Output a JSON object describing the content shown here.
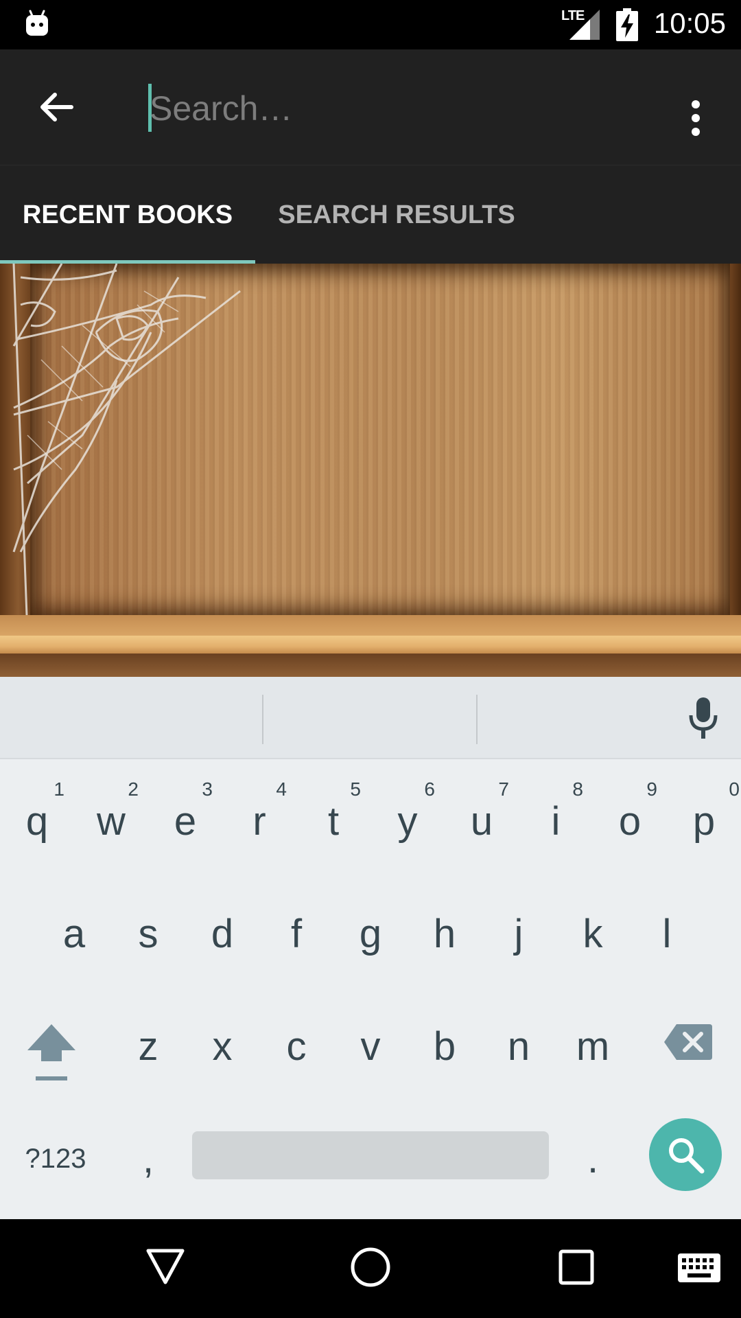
{
  "status_bar": {
    "network_label": "LTE",
    "time": "10:05"
  },
  "app_bar": {
    "search_placeholder": "Search…",
    "search_value": ""
  },
  "tabs": [
    {
      "label": "RECENT BOOKS",
      "selected": true
    },
    {
      "label": "SEARCH RESULTS",
      "selected": false
    }
  ],
  "keyboard": {
    "row1": [
      {
        "key": "q",
        "hint": "1"
      },
      {
        "key": "w",
        "hint": "2"
      },
      {
        "key": "e",
        "hint": "3"
      },
      {
        "key": "r",
        "hint": "4"
      },
      {
        "key": "t",
        "hint": "5"
      },
      {
        "key": "y",
        "hint": "6"
      },
      {
        "key": "u",
        "hint": "7"
      },
      {
        "key": "i",
        "hint": "8"
      },
      {
        "key": "o",
        "hint": "9"
      },
      {
        "key": "p",
        "hint": "0"
      }
    ],
    "row2": [
      "a",
      "s",
      "d",
      "f",
      "g",
      "h",
      "j",
      "k",
      "l"
    ],
    "row3": [
      "z",
      "x",
      "c",
      "v",
      "b",
      "n",
      "m"
    ],
    "symbols_key": "?123",
    "comma_key": ",",
    "period_key": "."
  },
  "colors": {
    "accent": "#4db6ac",
    "tab_indicator": "#7fc8bc",
    "app_bar": "#212121",
    "keyboard_bg": "#eceff1"
  },
  "icons": {
    "notification": "android-bot-icon",
    "back": "arrow-back-icon",
    "overflow": "more-vert-icon",
    "mic": "mic-icon",
    "shift": "shift-icon",
    "delete": "backspace-icon",
    "search": "search-icon",
    "nav_back": "triangle-back-icon",
    "nav_home": "circle-home-icon",
    "nav_recents": "square-recents-icon",
    "nav_keyboard": "keyboard-icon"
  }
}
